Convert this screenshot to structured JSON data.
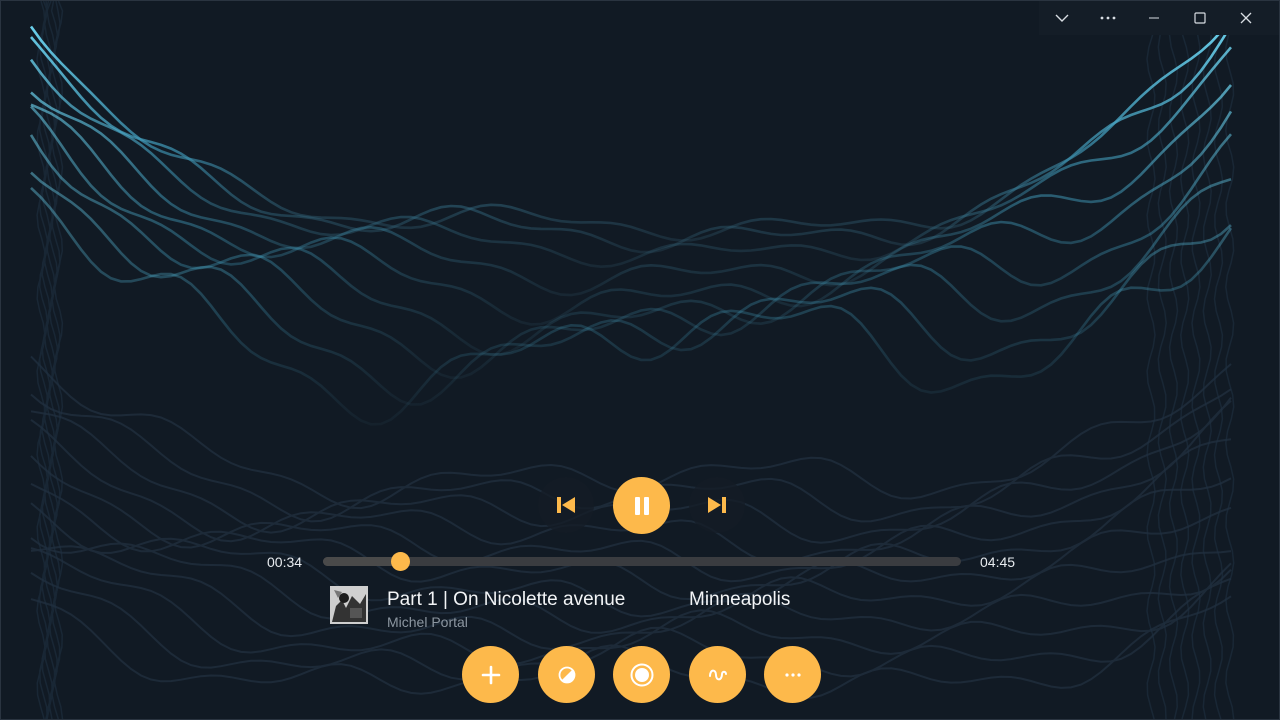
{
  "window": {
    "controls": [
      "chevron-down-icon",
      "more-icon",
      "minimize-icon",
      "maximize-icon",
      "close-icon"
    ]
  },
  "player": {
    "state": "playing",
    "elapsed": "00:34",
    "duration": "04:45",
    "progress": 0.12
  },
  "now_playing": {
    "title": "Part 1 | On Nicolette avenue",
    "artist": "Michel Portal",
    "album": "Minneapolis"
  },
  "actions": [
    "add-icon",
    "contrast-icon",
    "record-icon",
    "wave-icon",
    "more-icon"
  ],
  "colors": {
    "background": "#111a24",
    "accent": "#fdb94b",
    "visualizer": "#5fd0ee"
  }
}
